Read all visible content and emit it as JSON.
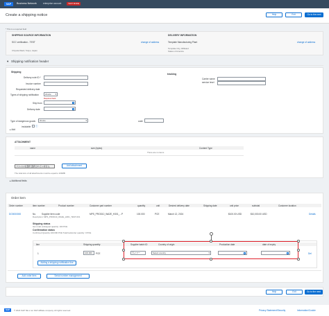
{
  "topbar": {
    "logo": "SAP",
    "network": "Business Network",
    "account": "enterprise account",
    "badge": "TEST MODE"
  },
  "title": "Create a shipping notice",
  "header_buttons": {
    "help": "Help",
    "exit": "Exit",
    "next": "Go to the next"
  },
  "required_note": "* This is a required field",
  "shipping_source": {
    "heading": "SHIPPING SOURCE INFORMATION",
    "name": "SCC verification - TEST",
    "change": "change of address",
    "address": "Chiyoda Ward, Tokyo, Japan"
  },
  "delivery": {
    "heading": "DELIVERY INFORMATION",
    "name": "Template Manufacturing Plant",
    "change": "change of address",
    "address1": "Template City, Affiliated",
    "address2": "States of America"
  },
  "section_header": "Shipping notification header",
  "shipping": {
    "heading": "Shipping",
    "fields": [
      "Delivery note ID *",
      "Invoice number",
      "Requested delivery date",
      "Types of shipping notification",
      "Ship from",
      "Delivery date"
    ],
    "type_value": "choice",
    "required_hint": "Required field",
    "dangerous_label": "Type of dangerous goods",
    "dangerous_value": "choice",
    "code_label": "code",
    "inviolable_label": "inviolable"
  },
  "tracking": {
    "heading": "tracking",
    "carrier_label": "Carrier name",
    "service_label": "service level"
  },
  "add_label": "Add",
  "attachment": {
    "heading": "ATTACHMENT",
    "columns": [
      "name",
      "size (bytes)",
      "Content Type"
    ],
    "empty": "There are no items",
    "choose_file": "ファイルを選択 選択されていません",
    "add_button": "Add attachment",
    "note": "The total size of all attachments must be equal to 100MB"
  },
  "additional_fields": "Additional fields",
  "order": {
    "heading": "Order item",
    "columns": [
      "Order number",
      "item number",
      "Product number",
      "Customer part number",
      "quantity",
      "unit",
      "Desired delivery date",
      "Shipping date",
      "unit price",
      "subtotal",
      "Customer location"
    ],
    "row": {
      "order_number": "DO0000000",
      "item_number": "No.",
      "product_number": "Supplier item code",
      "customer_part": "MPS_PROD10_WA2E_H301_...P",
      "quantity": "100.000",
      "unit": "PCE",
      "desired_date": "March 12, 2024",
      "unit_price": "$100.00 USD",
      "subtotal": "$10,000.00 USD",
      "details": "Details",
      "description": "Description: MPS_PROD10_WA2E_H301_TEST-001"
    },
    "shipping_status": "Shipping status",
    "status_line": "Item total unshipped quantity: 100 PCE",
    "confirmation": "Confirmation status",
    "confirm_line": "Confirmed Quantity    100.000 PCE    Total backorder quantity: 0 PCE"
  },
  "line_table": {
    "columns": [
      "line",
      "Shipping quantity",
      "Supplier batch ID",
      "Country of origin",
      "Production date",
      "date of expiry"
    ],
    "line_no": "1",
    "ship_qty": "100.000",
    "unit": "PCE",
    "batch_value": "ライフー",
    "country_value": "Select country",
    "delete": "Del",
    "add_line": "Adding a shipping notification line"
  },
  "bottom_buttons": {
    "add_order_item": "Add order item",
    "serial": "Serial number management"
  },
  "footer": {
    "copyright": "© 2024 SAP SE or an SAP affiliate company. All rights reserved.",
    "privacy": "Privacy Statement/Security",
    "cookie": "Information/Cookie"
  }
}
